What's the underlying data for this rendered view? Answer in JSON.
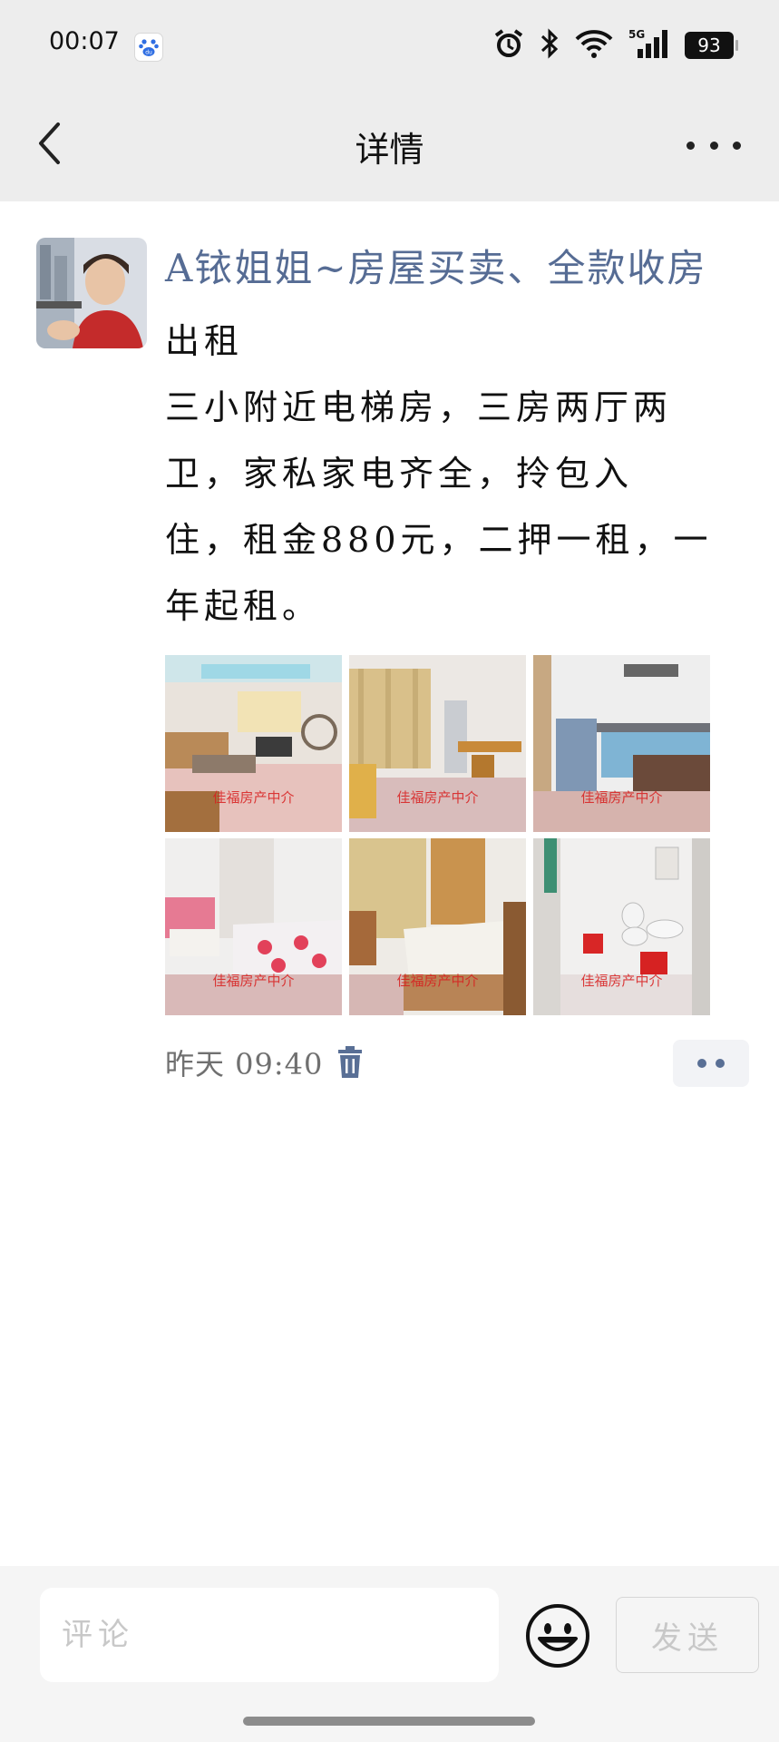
{
  "status_bar": {
    "time": "00:07",
    "app_icon": "baidu-paw-icon",
    "icons": [
      "alarm-icon",
      "bluetooth-icon",
      "wifi-icon",
      "5g-signal-icon"
    ],
    "battery": "93"
  },
  "nav": {
    "title": "详情",
    "back_icon": "chevron-left-icon",
    "more_icon": "more-dots-icon"
  },
  "post": {
    "author": "A铱姐姐~房屋买卖、全款收房",
    "lines": [
      "出租",
      "三小附近电梯房，三房两厅两",
      "卫，家私家电齐全，拎包入",
      "住，租金880元，二押一租，一",
      "年起租。"
    ],
    "photos": [
      {
        "name": "living-room",
        "watermark": "佳福房产中介"
      },
      {
        "name": "dining-room",
        "watermark": "佳福房产中介"
      },
      {
        "name": "kitchen",
        "watermark": "佳福房产中介"
      },
      {
        "name": "bedroom-one",
        "watermark": "佳福房产中介"
      },
      {
        "name": "bedroom-two",
        "watermark": "佳福房产中介"
      },
      {
        "name": "bathroom",
        "watermark": "佳福房产中介"
      }
    ],
    "time": "昨天 09:40",
    "delete_icon": "trash-icon",
    "action_icon": "two-dots-icon"
  },
  "comment_bar": {
    "placeholder": "评论",
    "emoji_icon": "smiley-icon",
    "send_label": "发送"
  },
  "colors": {
    "author": "#566c94",
    "top_bar": "#ededed",
    "watermark": "#d81e1e"
  }
}
